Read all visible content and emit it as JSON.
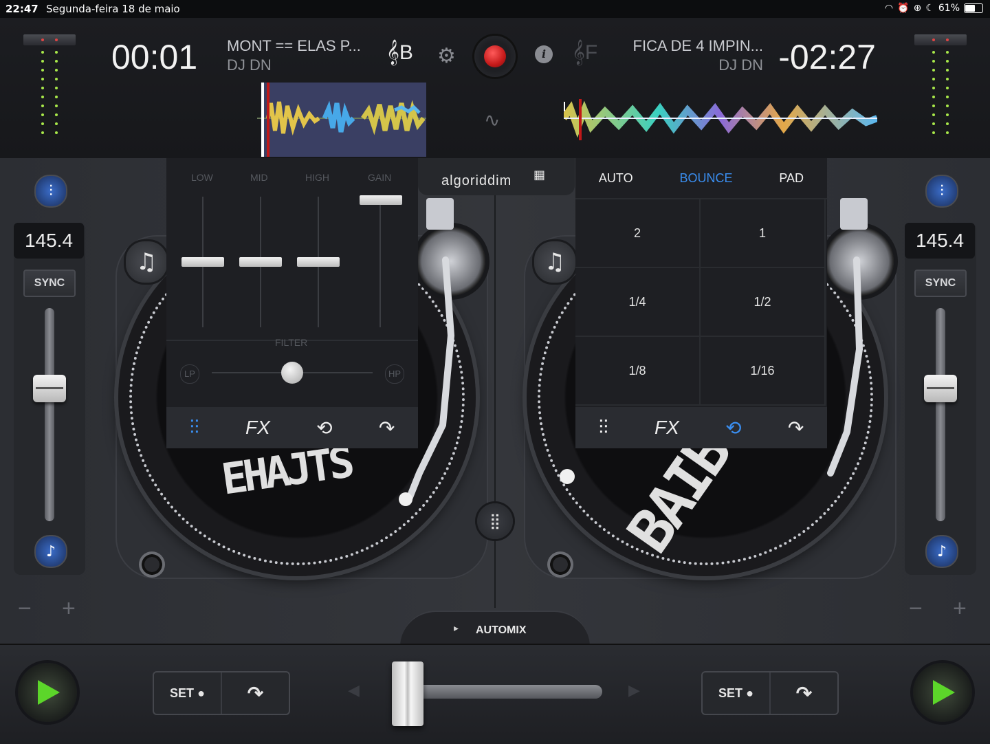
{
  "status": {
    "time": "22:47",
    "date": "Segunda-feira 18 de maio",
    "battery": "61%"
  },
  "deckA": {
    "elapsed": "00:01",
    "title": "MONT == ELAS P...",
    "artist": "DJ DN",
    "key": "B",
    "bpm": "145.4",
    "sync_label": "SYNC",
    "pitch_level": 0.38,
    "label_art": "EHAJTS"
  },
  "deckB": {
    "remaining": "-02:27",
    "title": "FICA DE 4 IMPIN...",
    "artist": "DJ DN",
    "key": "F",
    "bpm": "145.4",
    "sync_label": "SYNC",
    "pitch_level": 0.38,
    "label_art": "BAIB"
  },
  "brand": {
    "logo": "algoriddim"
  },
  "eq": {
    "labels": [
      "LOW",
      "MID",
      "HIGH",
      "GAIN"
    ],
    "filter_label": "FILTER",
    "lp_label": "LP",
    "hp_label": "HP",
    "filter_value": 0.5
  },
  "loop": {
    "tabs": [
      "AUTO",
      "BOUNCE",
      "PAD"
    ],
    "active_tab": "BOUNCE",
    "cells": [
      "2",
      "1",
      "1/4",
      "1/2",
      "1/8",
      "1/16"
    ]
  },
  "panel_tabs": {
    "fx_label": "FX"
  },
  "bottom": {
    "automix_label": "AUTOMIX",
    "set_label": "SET",
    "crossfader_position": 0.0
  },
  "colors": {
    "accent_blue": "#3a8ef0",
    "play_green": "#5cd62a",
    "record_red": "#c41a1a"
  },
  "icons": {
    "mixer": "sliders-icon",
    "loop": "loop-icon",
    "jump": "jump-icon",
    "settings": "gear-icon",
    "info": "info-icon",
    "record": "record-icon",
    "grid": "grid-icon",
    "note": "music-note-icon"
  }
}
